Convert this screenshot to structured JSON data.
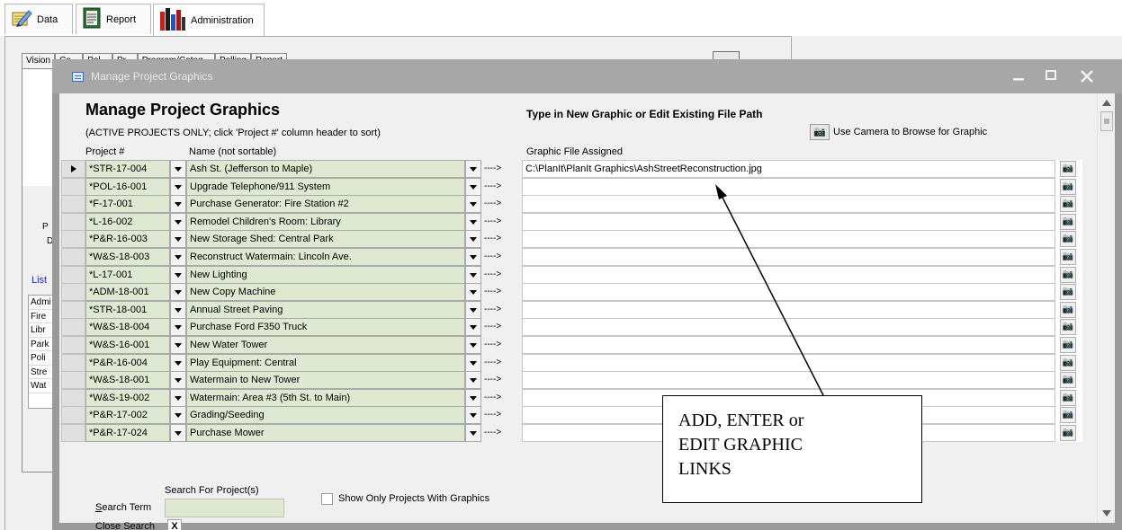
{
  "top_tabs": [
    {
      "label": "Data",
      "icon": "notebook-pencil-icon"
    },
    {
      "label": "Report",
      "icon": "report-icon"
    },
    {
      "label": "Administration",
      "icon": "books-icon"
    }
  ],
  "background": {
    "tab_labels": [
      "Vision",
      "Co...",
      "Pol...",
      "Pr...",
      "Program/Categ...",
      "Polling",
      "Report"
    ],
    "side_labels": [
      "P",
      "D",
      "List"
    ],
    "list_items": [
      "Admi",
      "Fire",
      "Libr",
      "Park",
      "Poli",
      "Stre",
      "Wat"
    ]
  },
  "dialog": {
    "window_title": "Manage Project Graphics",
    "heading": "Manage Project Graphics",
    "subheading": "(ACTIVE PROJECTS ONLY; click 'Project #' column header to sort)",
    "right_heading": "Type in New Graphic or Edit Existing File Path",
    "camera_browse_label": "Use Camera to Browse for Graphic",
    "columns": {
      "project": "Project #",
      "name": "Name (not sortable)",
      "graphic": "Graphic File Assigned"
    },
    "arrow_text": "---->",
    "rows": [
      {
        "project": "*STR-17-004",
        "name": "Ash St. (Jefferson to Maple)",
        "graphic": "C:\\PlanIt\\PlanIt Graphics\\AshStreetReconstruction.jpg",
        "current": true
      },
      {
        "project": "*POL-16-001",
        "name": "Upgrade Telephone/911 System",
        "graphic": ""
      },
      {
        "project": "*F-17-001",
        "name": "Purchase Generator: Fire Station #2",
        "graphic": ""
      },
      {
        "project": "*L-16-002",
        "name": "Remodel Children's Room: Library",
        "graphic": ""
      },
      {
        "project": "*P&R-16-003",
        "name": "New Storage Shed: Central Park",
        "graphic": ""
      },
      {
        "project": "*W&S-18-003",
        "name": "Reconstruct Watermain: Lincoln Ave.",
        "graphic": ""
      },
      {
        "project": "*L-17-001",
        "name": "New Lighting",
        "graphic": ""
      },
      {
        "project": "*ADM-18-001",
        "name": "New Copy Machine",
        "graphic": ""
      },
      {
        "project": "*STR-18-001",
        "name": "Annual Street Paving",
        "graphic": ""
      },
      {
        "project": "*W&S-18-004",
        "name": "Purchase Ford F350 Truck",
        "graphic": ""
      },
      {
        "project": "*W&S-16-001",
        "name": "New Water Tower",
        "graphic": ""
      },
      {
        "project": "*P&R-16-004",
        "name": "Play Equipment: Central",
        "graphic": ""
      },
      {
        "project": "*W&S-18-001",
        "name": "Watermain to New Tower",
        "graphic": ""
      },
      {
        "project": "*W&S-19-002",
        "name": "Watermain: Area #3 (5th St. to Main)",
        "graphic": ""
      },
      {
        "project": "*P&R-17-002",
        "name": "Grading/Seeding",
        "graphic": ""
      },
      {
        "project": "*P&R-17-024",
        "name": "Purchase Mower",
        "graphic": ""
      }
    ],
    "search_for_label": "Search For Project(s)",
    "search_term_label_key": "S",
    "search_term_label_rest": "earch Term",
    "search_term_value": "",
    "show_only_label": "Show Only Projects With Graphics",
    "close_search_label_key": "C",
    "close_search_label_rest": "lose Search",
    "close_search_x": "X",
    "callout_text": "ADD, ENTER or\nEDIT GRAPHIC\nLINKS"
  }
}
